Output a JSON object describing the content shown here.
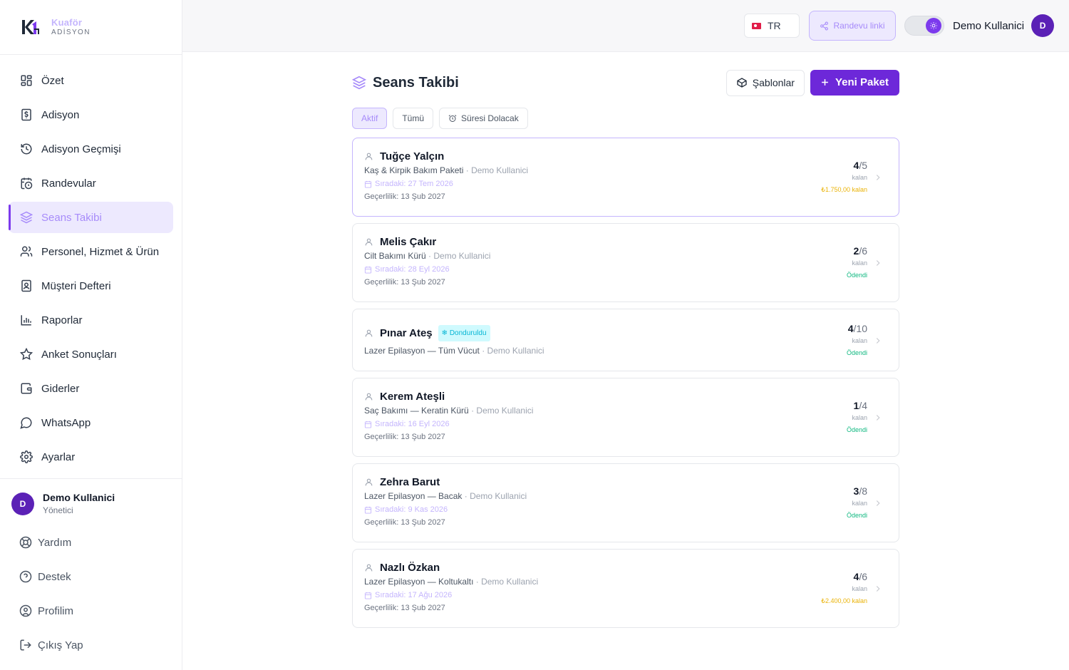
{
  "brand": {
    "name": "Kuaför",
    "sub": "ADİSYON"
  },
  "nav": [
    {
      "label": "Özet",
      "icon": "dashboard-icon"
    },
    {
      "label": "Adisyon",
      "icon": "receipt-icon"
    },
    {
      "label": "Adisyon Geçmişi",
      "icon": "history-icon"
    },
    {
      "label": "Randevular",
      "icon": "calendar-clock-icon"
    },
    {
      "label": "Seans Takibi",
      "icon": "layers-icon",
      "active": true
    },
    {
      "label": "Personel, Hizmet & Ürün",
      "icon": "users-icon"
    },
    {
      "label": "Müşteri Defteri",
      "icon": "contact-book-icon"
    },
    {
      "label": "Raporlar",
      "icon": "bar-chart-icon"
    },
    {
      "label": "Anket Sonuçları",
      "icon": "star-icon"
    },
    {
      "label": "Giderler",
      "icon": "wallet-icon"
    },
    {
      "label": "WhatsApp",
      "icon": "chat-icon"
    },
    {
      "label": "Ayarlar",
      "icon": "gear-icon"
    }
  ],
  "user": {
    "initial": "D",
    "name": "Demo Kullanici",
    "role": "Yönetici"
  },
  "footer": [
    {
      "label": "Yardım",
      "icon": "lifebuoy-icon"
    },
    {
      "label": "Destek",
      "icon": "help-circle-icon"
    },
    {
      "label": "Profilim",
      "icon": "user-circle-icon"
    },
    {
      "label": "Çıkış Yap",
      "icon": "logout-icon"
    }
  ],
  "topbar": {
    "lang": "TR",
    "link_label": "Randevu linki",
    "user_name": "Demo Kullanici",
    "user_initial": "D"
  },
  "page": {
    "title": "Seans Takibi",
    "templates_label": "Şablonlar",
    "new_label": "Yeni Paket"
  },
  "filters": [
    {
      "label": "Aktif",
      "active": true
    },
    {
      "label": "Tümü"
    },
    {
      "label": "Süresi Dolacak",
      "icon": "alarm-icon"
    }
  ],
  "cards": [
    {
      "name": "Tuğçe Yalçın",
      "package": "Kaş & Kirpik Bakım Paketi",
      "staff": "Demo Kullanici",
      "next": "Sıradaki: 27 Tem 2026",
      "valid": "Geçerlilik: 13 Şub 2027",
      "used": "4",
      "total": "/5",
      "kalan": "kalan",
      "payment": "₺1.750,00 kalan",
      "pay_status": "due",
      "selected": true
    },
    {
      "name": "Melis Çakır",
      "package": "Cilt Bakımı Kürü",
      "staff": "Demo Kullanici",
      "next": "Sıradaki: 28 Eyl 2026",
      "valid": "Geçerlilik: 13 Şub 2027",
      "used": "2",
      "total": "/6",
      "kalan": "kalan",
      "payment": "Ödendi",
      "pay_status": "paid"
    },
    {
      "name": "Pınar Ateş",
      "badge": "Donduruldu",
      "package": "Lazer Epilasyon — Tüm Vücut",
      "staff": "Demo Kullanici",
      "used": "4",
      "total": "/10",
      "kalan": "kalan",
      "payment": "Ödendi",
      "pay_status": "paid"
    },
    {
      "name": "Kerem Ateşli",
      "package": "Saç Bakımı — Keratin Kürü",
      "staff": "Demo Kullanici",
      "next": "Sıradaki: 16 Eyl 2026",
      "valid": "Geçerlilik: 13 Şub 2027",
      "used": "1",
      "total": "/4",
      "kalan": "kalan",
      "payment": "Ödendi",
      "pay_status": "paid"
    },
    {
      "name": "Zehra Barut",
      "package": "Lazer Epilasyon — Bacak",
      "staff": "Demo Kullanici",
      "next": "Sıradaki: 9 Kas 2026",
      "valid": "Geçerlilik: 13 Şub 2027",
      "used": "3",
      "total": "/8",
      "kalan": "kalan",
      "payment": "Ödendi",
      "pay_status": "paid"
    },
    {
      "name": "Nazlı Özkan",
      "package": "Lazer Epilasyon — Koltukaltı",
      "staff": "Demo Kullanici",
      "next": "Sıradaki: 17 Ağu 2026",
      "valid": "Geçerlilik: 13 Şub 2027",
      "used": "4",
      "total": "/6",
      "kalan": "kalan",
      "payment": "₺2.400,00 kalan",
      "pay_status": "due"
    }
  ],
  "colors": {
    "accent": "#6d28d9",
    "accent_soft": "#ede9fe",
    "paid": "#10b981",
    "due": "#eab308",
    "frozen": "#06b6d4"
  }
}
